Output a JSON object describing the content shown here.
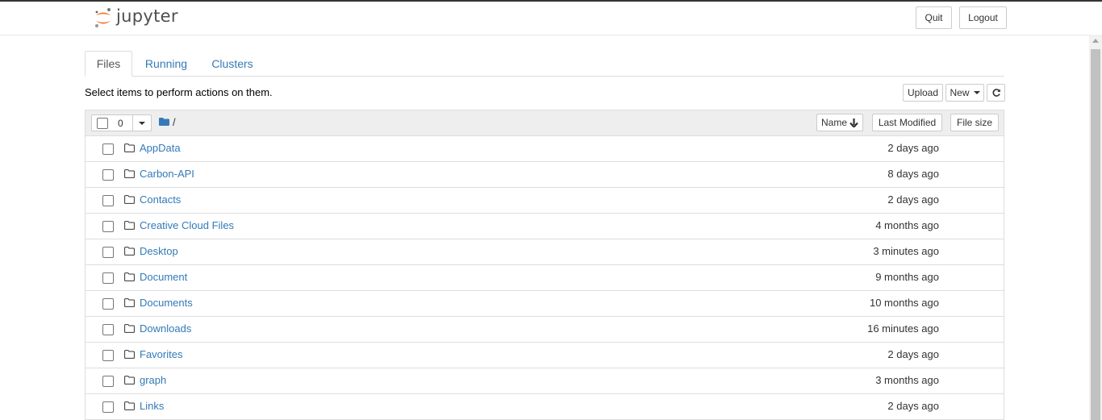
{
  "app": {
    "logo_text": "jupyter"
  },
  "header": {
    "quit_label": "Quit",
    "logout_label": "Logout"
  },
  "tabs": [
    {
      "label": "Files",
      "active": true
    },
    {
      "label": "Running",
      "active": false
    },
    {
      "label": "Clusters",
      "active": false
    }
  ],
  "toolbar": {
    "instructions": "Select items to perform actions on them.",
    "upload_label": "Upload",
    "new_label": "New",
    "refresh_icon": "refresh-icon"
  },
  "list_header": {
    "selected_count": "0",
    "breadcrumb_root": "/",
    "name_label": "Name",
    "sort_icon": "arrow-down-icon",
    "last_modified_label": "Last Modified",
    "file_size_label": "File size"
  },
  "rows": [
    {
      "name": "AppData",
      "modified": "2 days ago"
    },
    {
      "name": "Carbon-API",
      "modified": "8 days ago"
    },
    {
      "name": "Contacts",
      "modified": "2 days ago"
    },
    {
      "name": "Creative Cloud Files",
      "modified": "4 months ago"
    },
    {
      "name": "Desktop",
      "modified": "3 minutes ago"
    },
    {
      "name": "Document",
      "modified": "9 months ago"
    },
    {
      "name": "Documents",
      "modified": "10 months ago"
    },
    {
      "name": "Downloads",
      "modified": "16 minutes ago"
    },
    {
      "name": "Favorites",
      "modified": "2 days ago"
    },
    {
      "name": "graph",
      "modified": "3 months ago"
    },
    {
      "name": "Links",
      "modified": "2 days ago"
    }
  ],
  "colors": {
    "link": "#337ab7",
    "logo_orange": "#f37726",
    "logo_gray": "#767677"
  }
}
